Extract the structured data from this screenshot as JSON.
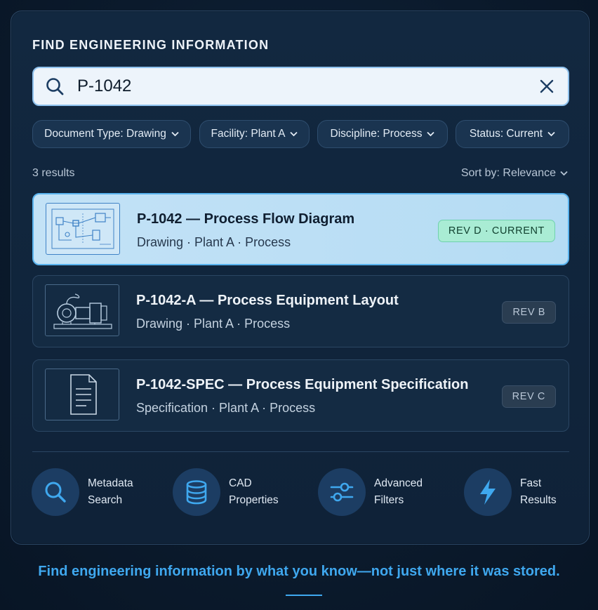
{
  "heading": "FIND ENGINEERING INFORMATION",
  "search": {
    "value": "P-1042"
  },
  "filters": [
    {
      "label": "Document Type: Drawing"
    },
    {
      "label": "Facility: Plant A"
    },
    {
      "label": "Discipline: Process"
    },
    {
      "label": "Status: Current"
    }
  ],
  "results_count": "3 results",
  "sort_label": "Sort by: Relevance",
  "results": [
    {
      "title": "P-1042 — Process Flow Diagram",
      "meta": "Drawing · Plant A · Process",
      "badge": "REV D · CURRENT",
      "thumbnail_icon": "process-flow-diagram-thumbnail"
    },
    {
      "title": "P-1042-A — Process Equipment Layout",
      "meta": "Drawing · Plant A · Process",
      "badge": "REV B",
      "thumbnail_icon": "pump-equipment-thumbnail"
    },
    {
      "title": "P-1042-SPEC — Process Equipment Specification",
      "meta": "Specification · Plant A · Process",
      "badge": "REV C",
      "thumbnail_icon": "document-icon"
    }
  ],
  "features": [
    {
      "line1": "Metadata",
      "line2": "Search",
      "icon": "search-icon"
    },
    {
      "line1": "CAD",
      "line2": "Properties",
      "icon": "database-icon"
    },
    {
      "line1": "Advanced",
      "line2": "Filters",
      "icon": "sliders-icon"
    },
    {
      "line1": "Fast",
      "line2": "Results",
      "icon": "lightning-icon"
    }
  ],
  "tagline": "Find engineering information by what you know—not just where it was stored.",
  "colors": {
    "accent": "#3fa8ef",
    "active_row": "#c3e2f6",
    "current_badge": "#a9ecd4",
    "panel": "#122840"
  }
}
